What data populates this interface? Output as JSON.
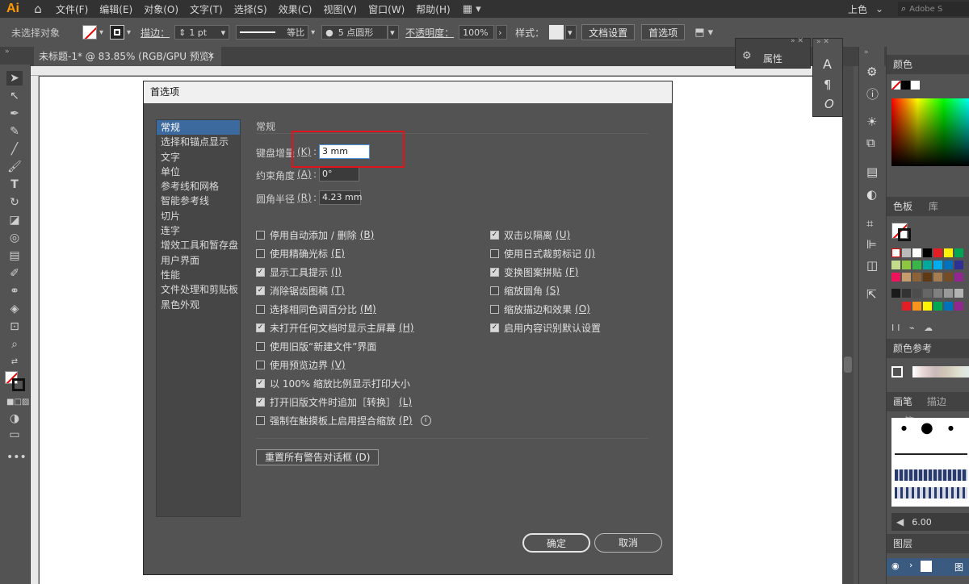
{
  "menubar": {
    "logo": "Ai",
    "items": [
      "文件(F)",
      "编辑(E)",
      "对象(O)",
      "文字(T)",
      "选择(S)",
      "效果(C)",
      "视图(V)",
      "窗口(W)",
      "帮助(H)"
    ],
    "workspace": "上色",
    "search_placeholder": "Adobe S"
  },
  "controlbar": {
    "selection_label": "未选择对象",
    "stroke_label": "描边：",
    "stroke_value": "1 pt",
    "profile_label": "等比",
    "brush_label": "5 点圆形",
    "opacity_label": "不透明度：",
    "opacity_value": "100%",
    "style_label": "样式：",
    "doc_setup_btn": "文档设置",
    "prefs_btn": "首选项"
  },
  "tab": {
    "title": "未标题-1* @ 83.85% (RGB/GPU 预览)",
    "close": "✕"
  },
  "prop_panel": {
    "label": "属性"
  },
  "right_panel": {
    "color_title": "颜色",
    "swatches_tab": "色板",
    "library_tab": "库",
    "color_guide": "颜色参考",
    "brush_tab": "画笔",
    "stroke_tab": "描边",
    "symbol_tab": "符",
    "brush_size": "6.00",
    "layers_title": "图层",
    "layer_name": "图"
  },
  "colors": {
    "highlight": "#e0151b",
    "selection": "#3c6a9f",
    "logo": "#ff9a00"
  },
  "dialog": {
    "title": "首选项",
    "categories": [
      "常规",
      "选择和锚点显示",
      "文字",
      "单位",
      "参考线和网格",
      "智能参考线",
      "切片",
      "连字",
      "增效工具和暂存盘",
      "用户界面",
      "性能",
      "文件处理和剪贴板",
      "黑色外观"
    ],
    "section_title": "常规",
    "keyboard_increment_label": "键盘增量",
    "keyboard_increment_key": "(K)",
    "keyboard_increment_value": "3 mm",
    "constrain_angle_label": "约束角度",
    "constrain_angle_key": "(A)",
    "constrain_angle_value": "0°",
    "corner_radius_label": "圆角半径",
    "corner_radius_key": "(R)",
    "corner_radius_value": "4.23 mm",
    "left_options": [
      {
        "label": "停用自动添加 / 删除",
        "key": "(B)",
        "checked": false
      },
      {
        "label": "使用精确光标",
        "key": "(E)",
        "checked": false
      },
      {
        "label": "显示工具提示",
        "key": "(I)",
        "checked": true
      },
      {
        "label": "消除锯齿图稿",
        "key": "(T)",
        "checked": true
      },
      {
        "label": "选择相同色调百分比",
        "key": "(M)",
        "checked": false
      },
      {
        "label": "未打开任何文档时显示主屏幕",
        "key": "(H)",
        "checked": true
      },
      {
        "label": "使用旧版“新建文件”界面",
        "key": "",
        "checked": false
      },
      {
        "label": "使用预览边界",
        "key": "(V)",
        "checked": false
      },
      {
        "label": "以 100% 缩放比例显示打印大小",
        "key": "",
        "checked": true
      },
      {
        "label": "打开旧版文件时追加［转换］",
        "key": "(L)",
        "checked": true
      },
      {
        "label": "强制在触摸板上启用捏合缩放",
        "key": "(P)",
        "checked": false
      }
    ],
    "right_options": [
      {
        "label": "双击以隔离",
        "key": "(U)",
        "checked": true
      },
      {
        "label": "使用日式裁剪标记",
        "key": "(J)",
        "checked": false
      },
      {
        "label": "变换图案拼贴",
        "key": "(F)",
        "checked": true
      },
      {
        "label": "缩放圆角",
        "key": "(S)",
        "checked": false
      },
      {
        "label": "缩放描边和效果",
        "key": "(O)",
        "checked": false
      },
      {
        "label": "启用内容识别默认设置",
        "key": "",
        "checked": true
      }
    ],
    "reset_warnings_btn": "重置所有警告对话框 (D)",
    "ok_btn": "确定",
    "cancel_btn": "取消"
  }
}
